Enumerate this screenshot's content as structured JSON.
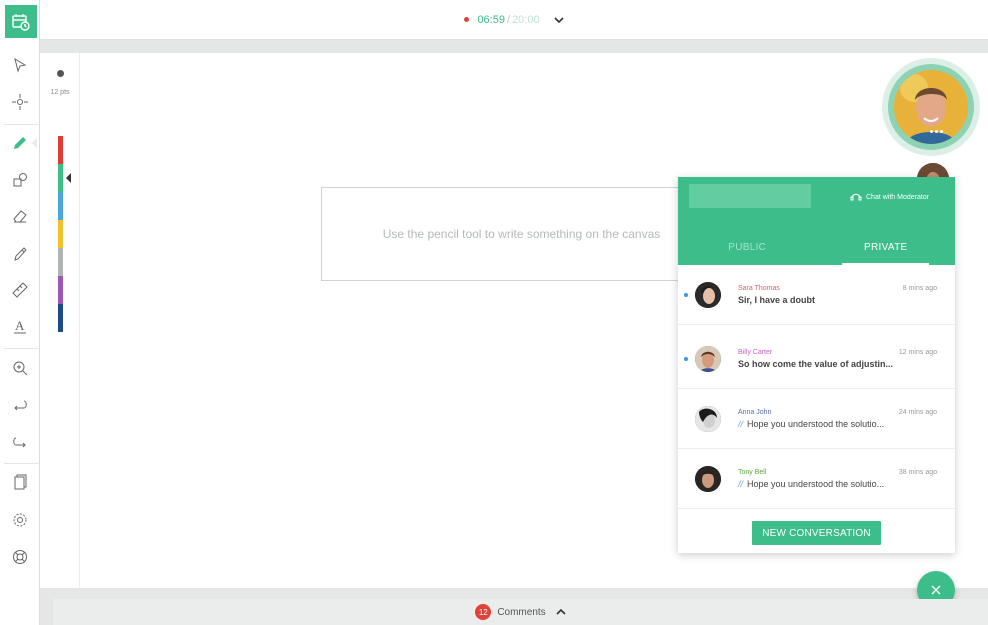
{
  "timer": {
    "current": "06:59",
    "separator": "/",
    "total": "20:00"
  },
  "toolbar": {
    "tools": [
      "select-icon",
      "move-icon",
      "pencil-icon",
      "shapes-icon",
      "eraser-icon",
      "highlighter-icon",
      "ruler-icon",
      "text-icon",
      "zoom-icon",
      "undo-icon",
      "redo-icon",
      "pages-icon",
      "settings-icon",
      "help-icon"
    ],
    "active_tool": "pencil-icon"
  },
  "brush": {
    "size_label": "12 pts"
  },
  "palette": [
    "#e03a35",
    "#3cbd8a",
    "#4aa6dd",
    "#f2c12e",
    "#b0b5b4",
    "#9b59b6",
    "#1f4a8a"
  ],
  "canvas": {
    "hint": "Use the pencil tool to write something on the canvas"
  },
  "chat": {
    "moderator_label": "Chat with Moderator",
    "tabs": [
      {
        "label": "PUBLIC",
        "active": false
      },
      {
        "label": "PRIVATE",
        "active": true
      }
    ],
    "conversations": [
      {
        "name": "Sara Thomas",
        "name_color": "#e0626b",
        "time": "8 mins ago",
        "message": "Sir, I have a doubt",
        "unread": true,
        "seen": false
      },
      {
        "name": "Billy Carter",
        "name_color": "#c864c8",
        "time": "12 mins ago",
        "message": "So how come the value of adjustin...",
        "unread": true,
        "seen": false
      },
      {
        "name": "Anna John",
        "name_color": "#5b6bb5",
        "time": "24 mins ago",
        "message": "Hope you understood the solutio...",
        "unread": false,
        "seen": true
      },
      {
        "name": "Tony Bell",
        "name_color": "#5aab3c",
        "time": "38 mins ago",
        "message": "Hope you understood the solutio...",
        "unread": false,
        "seen": true
      }
    ],
    "new_conversation_label": "NEW CONVERSATION"
  },
  "comments": {
    "count": "12",
    "label": "Comments"
  },
  "colors": {
    "accent": "#3cbd8a",
    "alert": "#e0423a"
  }
}
